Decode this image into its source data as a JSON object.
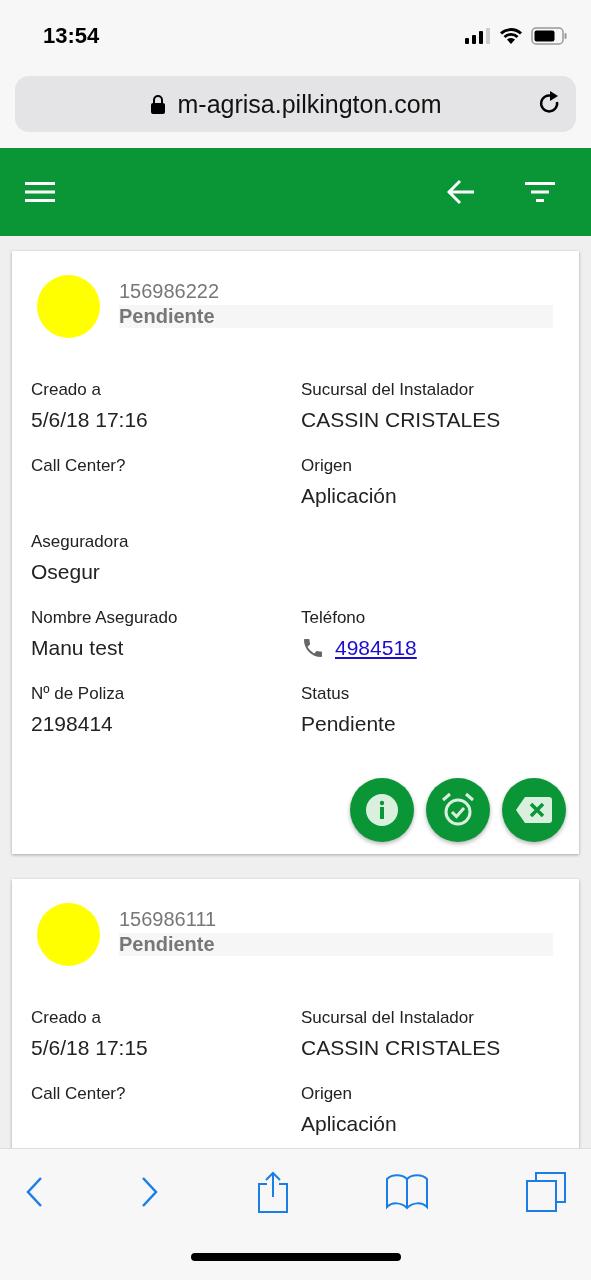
{
  "status_bar": {
    "time": "13:54"
  },
  "browser": {
    "url": "m-agrisa.pilkington.com"
  },
  "cards": [
    {
      "color": "#ffff00",
      "number": "156986222",
      "state": "Pendiente",
      "rows": [
        {
          "cells": [
            {
              "label": "Creado a",
              "value": "5/6/18 17:16"
            },
            {
              "label": "Sucursal del Instalador",
              "value": "CASSIN CRISTALES"
            }
          ]
        },
        {
          "cells": [
            {
              "label": "Call Center?"
            },
            {
              "label": "Origen",
              "value": "Aplicación"
            }
          ]
        },
        {
          "cells": [
            {
              "label": "Aseguradora",
              "value": "Osegur"
            }
          ]
        },
        {
          "cells": [
            {
              "label": "Nombre Asegurado",
              "value": "Manu test"
            },
            {
              "label": "Teléfono",
              "value": "4984518",
              "kind": "phone"
            }
          ]
        },
        {
          "cells": [
            {
              "label": "Nº de Poliza",
              "value": "2198414"
            },
            {
              "label": "Status",
              "value": "Pendiente"
            }
          ]
        }
      ],
      "actions": [
        {
          "kind": "info"
        },
        {
          "kind": "alarm"
        },
        {
          "kind": "delete"
        }
      ]
    },
    {
      "color": "#ffff00",
      "number": "156986111",
      "state": "Pendiente",
      "rows": [
        {
          "cells": [
            {
              "label": "Creado a",
              "value": "5/6/18 17:15"
            },
            {
              "label": "Sucursal del Instalador",
              "value": "CASSIN CRISTALES"
            }
          ]
        },
        {
          "cells": [
            {
              "label": "Call Center?"
            },
            {
              "label": "Origen",
              "value": "Aplicación"
            }
          ]
        }
      ]
    }
  ]
}
